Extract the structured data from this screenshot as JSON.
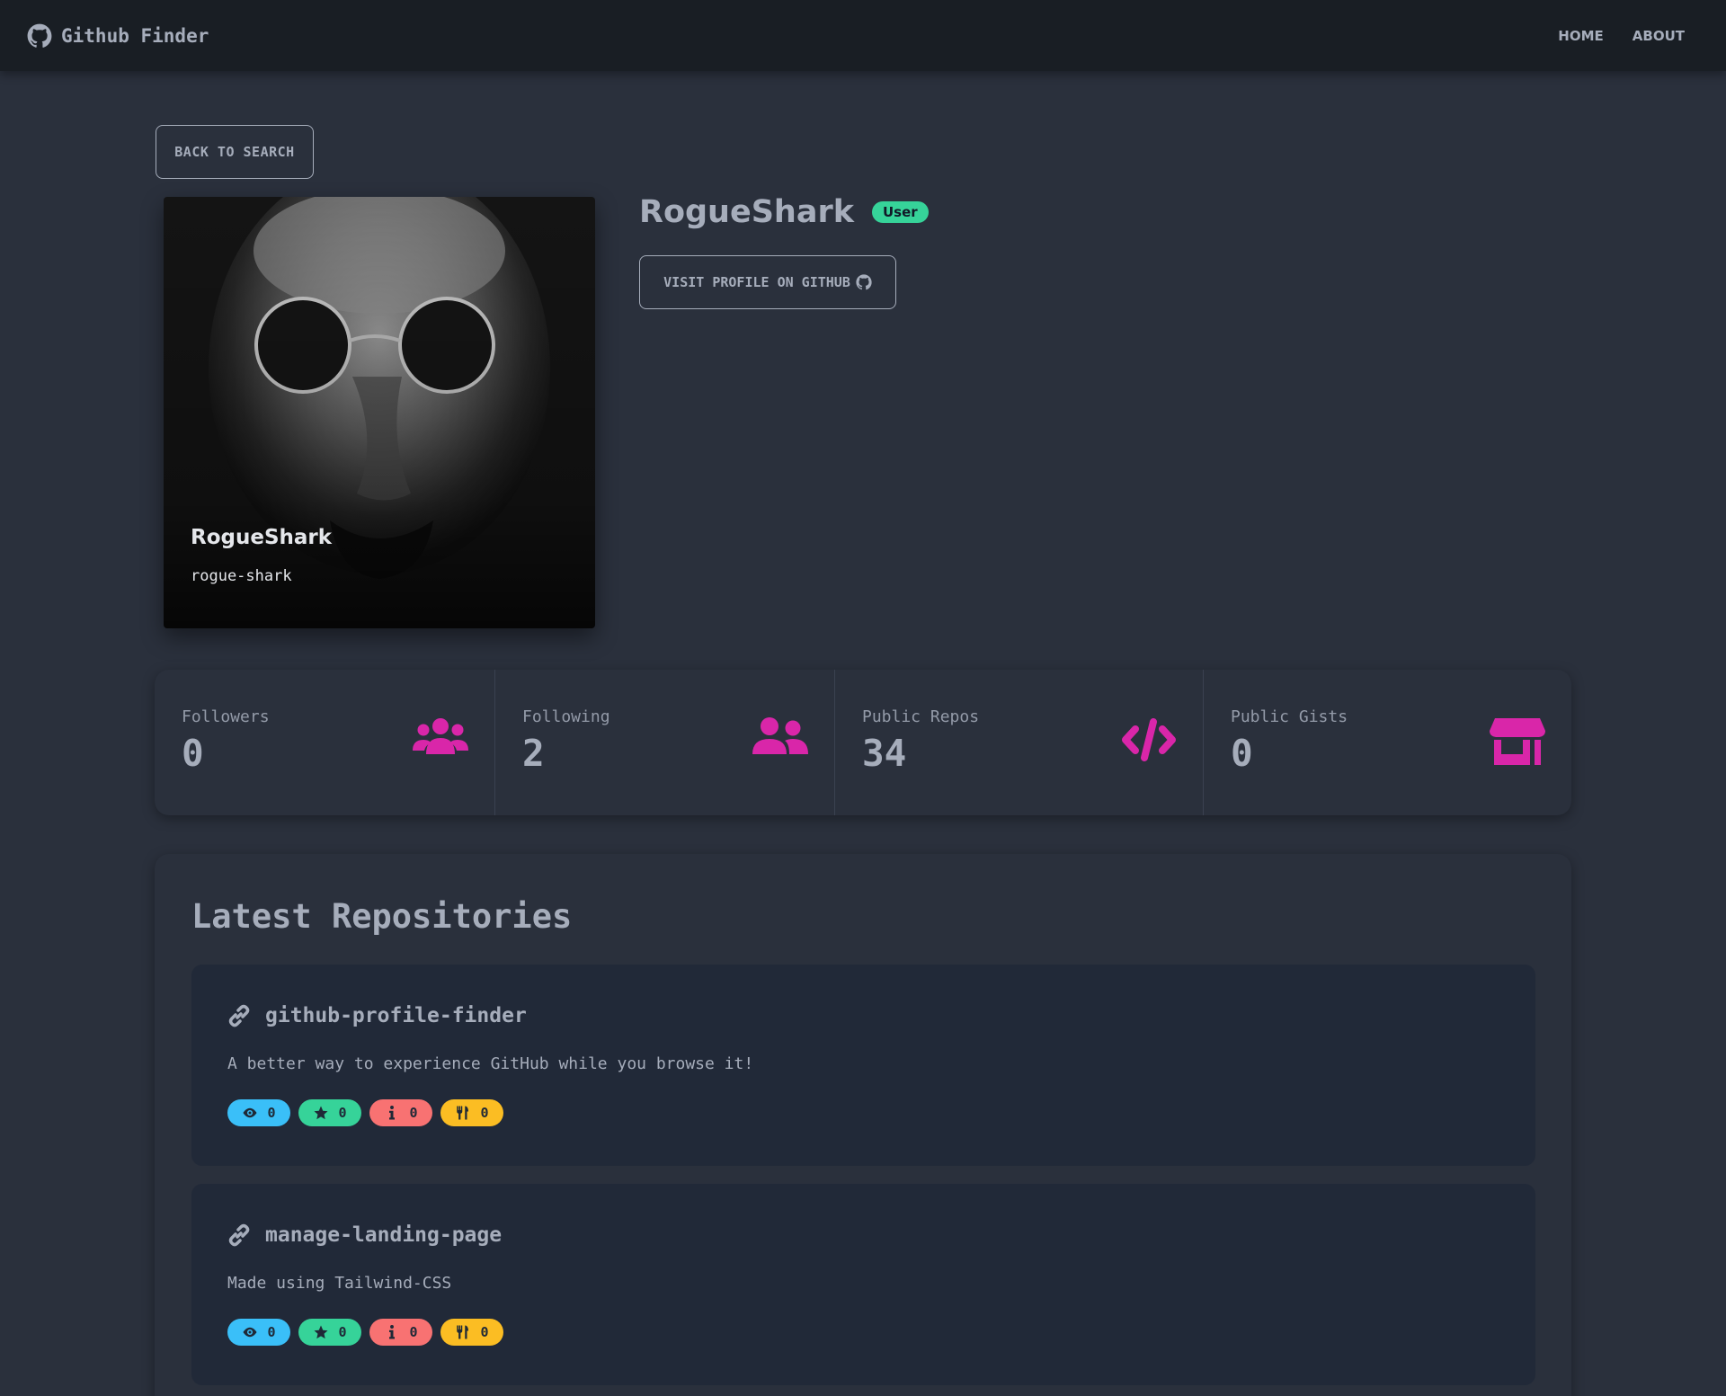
{
  "navbar": {
    "brand": "Github Finder",
    "brand_icon": "github-icon",
    "links": [
      "HOME",
      "ABOUT"
    ]
  },
  "back_button": "BACK TO SEARCH",
  "profile": {
    "display_name": "RogueShark",
    "login": "rogue-shark",
    "type_badge": "User",
    "visit_button": "VISIT PROFILE ON GITHUB"
  },
  "stats": [
    {
      "title": "Followers",
      "value": "0",
      "icon": "users-icon"
    },
    {
      "title": "Following",
      "value": "2",
      "icon": "user-friends-icon"
    },
    {
      "title": "Public Repos",
      "value": "34",
      "icon": "code-icon"
    },
    {
      "title": "Public Gists",
      "value": "0",
      "icon": "store-icon"
    }
  ],
  "repos": {
    "title": "Latest Repositories",
    "items": [
      {
        "name": "github-profile-finder",
        "description": "A better way to experience GitHub while you browse it!",
        "watchers": "0",
        "stars": "0",
        "issues": "0",
        "forks": "0"
      },
      {
        "name": "manage-landing-page",
        "description": "Made using Tailwind-CSS",
        "watchers": "0",
        "stars": "0",
        "issues": "0",
        "forks": "0"
      }
    ]
  },
  "colors": {
    "background": "#2a303c",
    "navbar": "#191e24",
    "accent_icon": "#d926a9",
    "badge_user": "#36d399",
    "badge_watchers": "#3abff8",
    "badge_stars": "#36d399",
    "badge_issues": "#f87272",
    "badge_forks": "#fbbd23"
  }
}
